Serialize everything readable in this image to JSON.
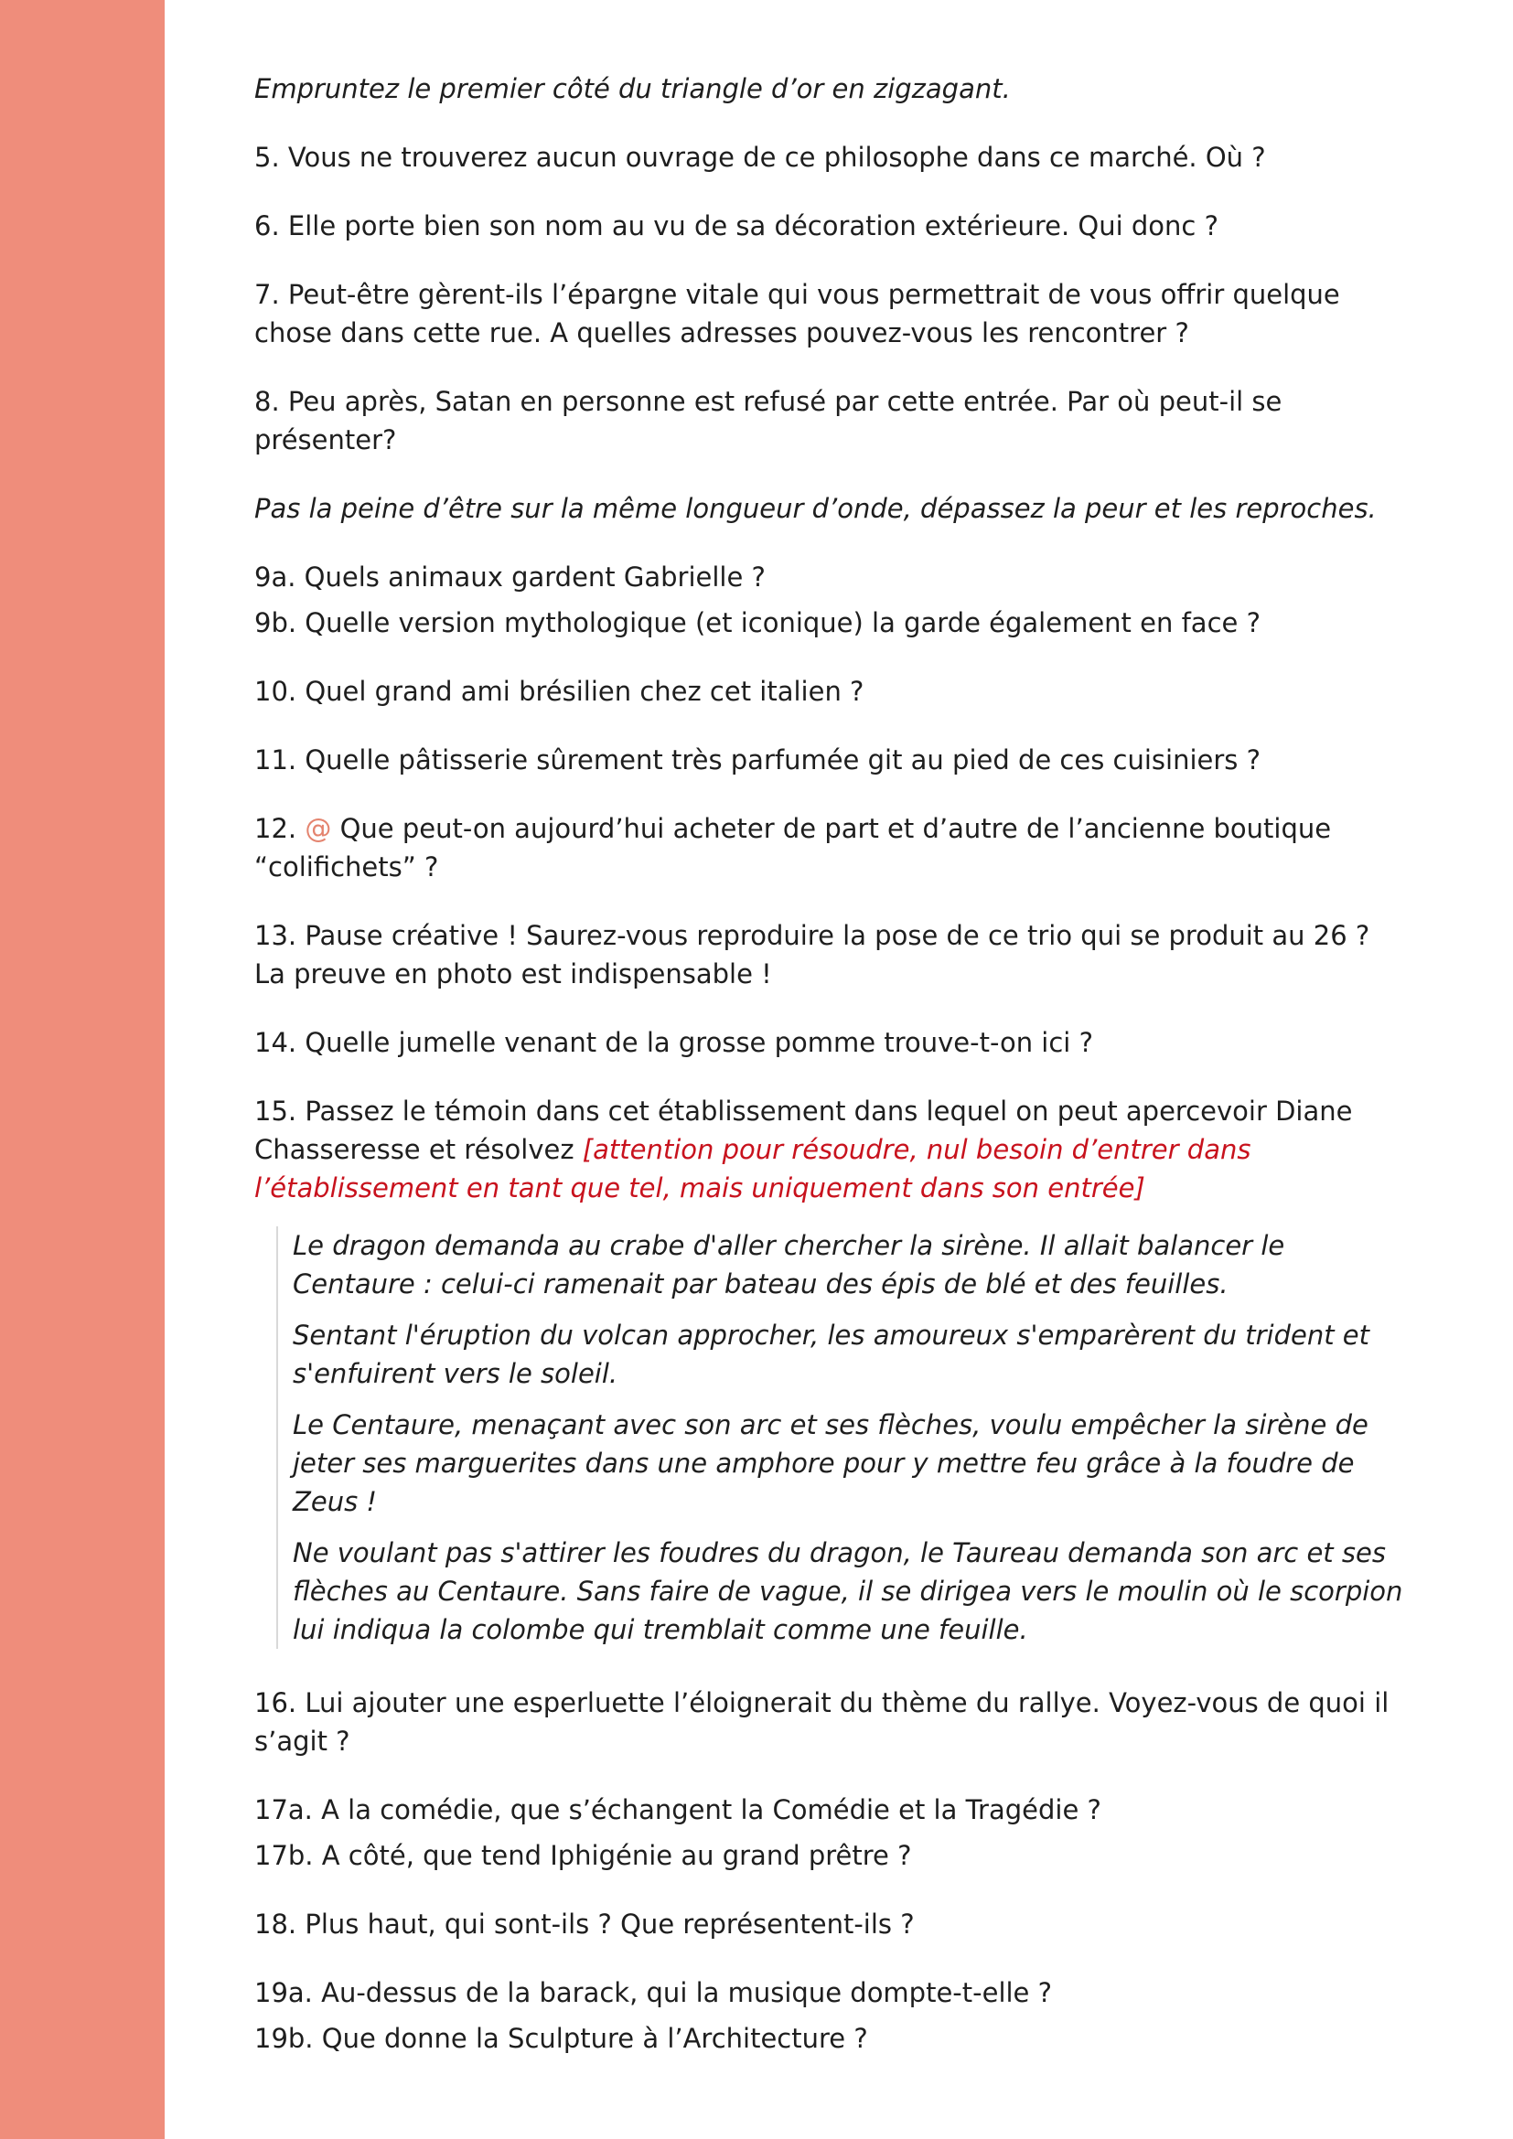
{
  "colors": {
    "band": "#ef8d7b",
    "red_note": "#c8121d",
    "at_icon": "#e4846f"
  },
  "icons": {
    "at": "@"
  },
  "items": {
    "intro": "Empruntez le premier côté du triangle d’or en zigzagant.",
    "q5": "5. Vous ne trouverez aucun ouvrage de ce philosophe dans ce marché. Où ?",
    "q6": "6. Elle porte bien son nom au vu de sa décoration extérieure. Qui donc ?",
    "q7": "7. Peut-être gèrent-ils l’épargne vitale qui vous permettrait de vous offrir quelque chose dans cette rue. A quelles adresses pouvez-vous les rencontrer ?",
    "q8": "8. Peu après, Satan en personne est refusé par cette entrée. Par où peut-il se présenter?",
    "hint2": "Pas la peine d’être sur la même longueur d’onde, dépassez la peur et les reproches.",
    "q9a": "9a. Quels animaux gardent Gabrielle ?",
    "q9b": "9b. Quelle version mythologique (et iconique) la garde également en face ?",
    "q10": "10. Quel grand ami brésilien chez cet italien ?",
    "q11": "11. Quelle pâtisserie sûrement très parfumée git au pied de ces cuisiniers ?",
    "q12_num": "12.",
    "q12_text": "Que peut-on aujourd’hui acheter de part et d’autre de l’ancienne boutique “colifichets” ?",
    "q13": "13. Pause créative ! Saurez-vous reproduire la pose de ce trio qui se produit au 26 ? La preuve en photo est indispensable !",
    "q14": "14. Quelle jumelle venant de la grosse pomme trouve-t-on ici ?",
    "q15_text": "15. Passez le témoin dans cet établissement dans lequel on peut apercevoir Diane Chasseresse et résolvez",
    "q15_note": "[attention pour résoudre, nul besoin d’entrer dans l’établissement en tant que tel, mais uniquement dans son entrée]",
    "q16": "16. Lui ajouter une esperluette l’éloignerait du thème du rallye. Voyez-vous de quoi il s’agit ?",
    "q17a": "17a. A la comédie, que s’échangent la Comédie et la Tragédie ?",
    "q17b": "17b. A côté, que tend Iphigénie au grand prêtre ?",
    "q18": "18. Plus haut, qui sont-ils ? Que représentent-ils ?",
    "q19a": "19a. Au-dessus de la barack, qui la musique dompte-t-elle ?",
    "q19b": "19b. Que donne la Sculpture à l’Architecture ?"
  },
  "quote": [
    "Le dragon demanda au crabe d'aller chercher la sirène. Il allait balancer le Centaure : celui-ci ramenait par bateau des épis de blé et des feuilles.",
    "Sentant l'éruption du volcan approcher, les amoureux s'emparèrent du trident et s'enfuirent vers le soleil.",
    "Le Centaure, menaçant avec son arc et ses flèches, voulu empêcher la sirène de jeter ses marguerites dans une amphore pour y mettre feu grâce à la foudre de Zeus !",
    "Ne voulant pas s'attirer les foudres du dragon, le Taureau demanda son arc et ses flèches au Centaure. Sans faire de vague, il se dirigea vers le moulin où le scorpion lui indiqua la colombe qui tremblait comme une feuille."
  ]
}
